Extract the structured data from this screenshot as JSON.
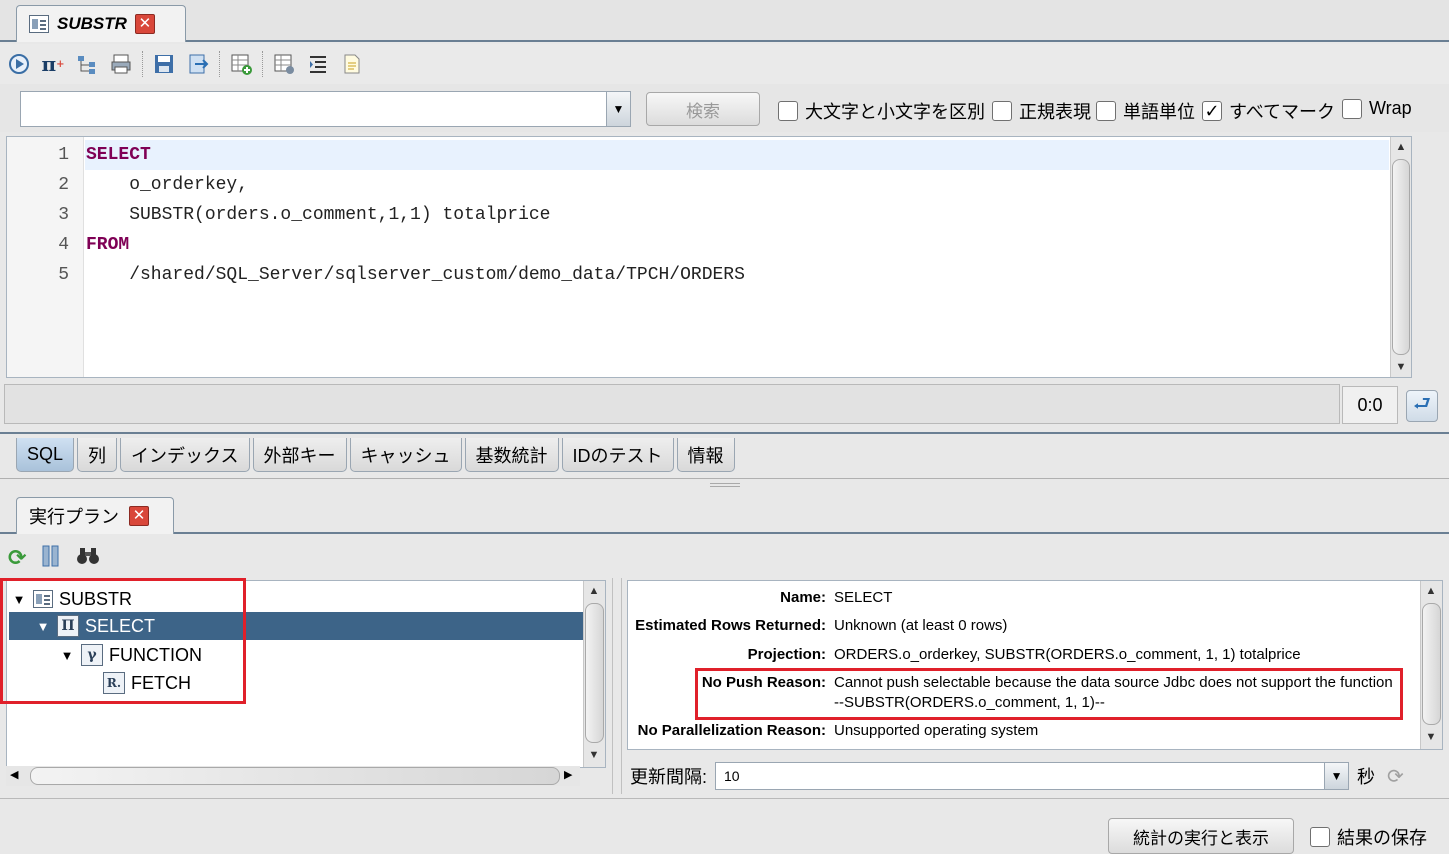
{
  "document_tab": {
    "title": "SUBSTR"
  },
  "toolbar": {
    "icons": [
      "run-icon",
      "pi-icon",
      "tree-icon",
      "print-icon",
      "save-icon",
      "export-icon",
      "add-table-icon",
      "table-settings-icon",
      "indent-icon",
      "page-icon"
    ]
  },
  "search": {
    "value": "",
    "search_button": "検索",
    "options": [
      {
        "label": "大文字と小文字を区別",
        "checked": false
      },
      {
        "label": "正規表現",
        "checked": false
      },
      {
        "label": "単語単位",
        "checked": false
      },
      {
        "label": "すべてマーク",
        "checked": true
      },
      {
        "label": "Wrap",
        "checked": false
      }
    ]
  },
  "editor": {
    "line_numbers": [
      "1",
      "2",
      "3",
      "4",
      "5"
    ],
    "lines": [
      {
        "kw": "SELECT",
        "text": ""
      },
      {
        "kw": "",
        "text": "    o_orderkey,"
      },
      {
        "kw": "",
        "text": "    SUBSTR(orders.o_comment,1,1) totalprice"
      },
      {
        "kw": "FROM",
        "text": ""
      },
      {
        "kw": "",
        "text": "    /shared/SQL_Server/sqlserver_custom/demo_data/TPCH/ORDERS"
      }
    ]
  },
  "status": {
    "cursor_pos": "0:0"
  },
  "sub_tabs": [
    "SQL",
    "列",
    "インデックス",
    "外部キー",
    "キャッシュ",
    "基数統計",
    "IDのテスト",
    "情報"
  ],
  "plan_tab": {
    "title": "実行プラン"
  },
  "tree": [
    {
      "label": "SUBSTR",
      "icon": "document-icon",
      "symbol": ""
    },
    {
      "label": "SELECT",
      "icon": "pi-icon",
      "symbol": "Π"
    },
    {
      "label": "FUNCTION",
      "icon": "gamma-icon",
      "symbol": "γ"
    },
    {
      "label": "FETCH",
      "icon": "relation-icon",
      "symbol": "R."
    }
  ],
  "details": [
    {
      "key": "Name:",
      "value": "SELECT"
    },
    {
      "key": "Estimated Rows Returned:",
      "value": "Unknown (at least 0 rows)"
    },
    {
      "key": "Projection:",
      "value": "ORDERS.o_orderkey, SUBSTR(ORDERS.o_comment, 1, 1) totalprice"
    },
    {
      "key": "No Push Reason:",
      "value": "Cannot push selectable because the data source Jdbc does not support the function --SUBSTR(ORDERS.o_comment, 1, 1)--"
    },
    {
      "key": "No Parallelization Reason:",
      "value": "Unsupported operating system"
    }
  ],
  "refresh": {
    "label": "更新間隔:",
    "value": "10",
    "unit": "秒"
  },
  "bottom": {
    "run_button": "統計の実行と表示",
    "save_label": "結果の保存"
  },
  "colors": {
    "highlight": "#e0202a",
    "selection": "#3d6488",
    "keyword": "#7f0055"
  }
}
